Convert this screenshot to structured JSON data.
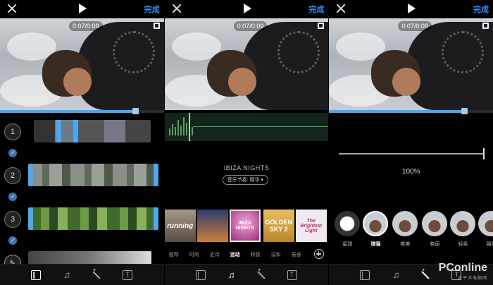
{
  "common": {
    "done_label": "完成",
    "timecode": "0:07/0:09"
  },
  "panel1": {
    "clips": [
      "1",
      "2",
      "3"
    ],
    "progress": 0.82
  },
  "panel2": {
    "song_title": "IBIZA NIGHTS",
    "rhythm_label": "音乐节奏: 精华 ▾",
    "albums": [
      {
        "label": "running",
        "color": "#8a7e72"
      },
      {
        "label": "",
        "color": "#c9834e"
      },
      {
        "label": "IBIZA NIGHTS",
        "color": "#d46ab4"
      },
      {
        "label": "GOLDEN SKY 2",
        "color": "#d6a93c"
      },
      {
        "label": "The Brightest Light",
        "color": "#e8e3ea"
      }
    ],
    "genres": [
      "推荐",
      "时尚",
      "史诗",
      "运动",
      "积极",
      "温和",
      "振奋"
    ],
    "active_genre": "运动"
  },
  "panel3": {
    "intensity": "100%",
    "filters": [
      "星球",
      "增强",
      "唯美",
      "艳丽",
      "轻柔",
      "强烈"
    ],
    "active_filter": "增强"
  },
  "watermark": {
    "brand": "PConline",
    "sub": "太平洋电脑网"
  }
}
